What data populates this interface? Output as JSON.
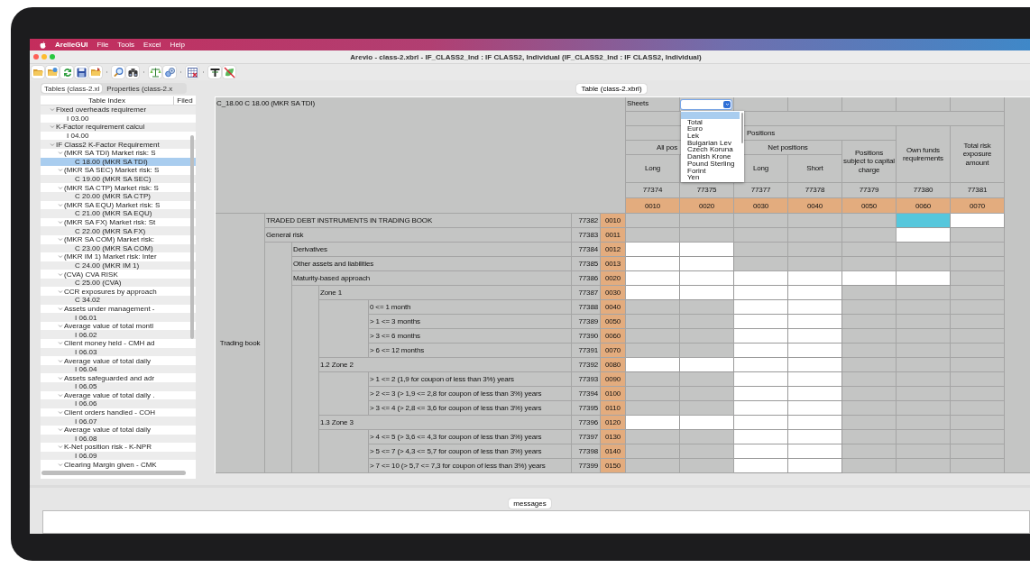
{
  "menubar": {
    "app": "ArelleGUI",
    "items": [
      "File",
      "Tools",
      "Excel",
      "Help"
    ]
  },
  "window": {
    "title": "Arevio - class-2.xbrl - IF_CLASS2_Ind : IF CLASS2, Individual (IF_CLASS2_Ind : IF CLASS2, Individual)"
  },
  "toolbar": {
    "groups": [
      [
        {
          "kind": "folder-open"
        },
        {
          "kind": "folder-star"
        },
        {
          "kind": "arrows"
        },
        {
          "kind": "disk"
        },
        {
          "kind": "folder-arrow"
        }
      ],
      [
        {
          "kind": "magnifier"
        },
        {
          "kind": "binoculars"
        }
      ],
      [
        {
          "kind": "scales"
        },
        {
          "kind": "magnifier-gear"
        }
      ],
      [
        {
          "kind": "table"
        }
      ],
      [
        {
          "kind": "tee"
        },
        {
          "kind": "crossed"
        }
      ]
    ]
  },
  "left_panel": {
    "tabs": [
      {
        "label": "Tables (class-2.xl",
        "selected": true
      },
      {
        "label": "Properties (class-2.x",
        "selected": false
      }
    ],
    "columns": [
      "Table Index",
      "Filed"
    ],
    "tree": [
      {
        "label": "Fixed overheads requiremer",
        "expanded": true,
        "selected": false,
        "children": [
          {
            "label": "I 03.00",
            "selected": false
          }
        ]
      },
      {
        "label": "K-Factor requirement calcul",
        "expanded": true,
        "selected": false,
        "children": [
          {
            "label": "I 04.00",
            "selected": false
          }
        ]
      },
      {
        "label": "IF Class2 K-Factor Requirement",
        "expanded": true,
        "selected": false,
        "children": [
          {
            "label": "(MKR SA TDI) Market risk: S",
            "expanded": true,
            "selected": false,
            "children": [
              {
                "label": "C 18.00 (MKR SA TDI)",
                "selected": true
              }
            ]
          },
          {
            "label": "(MKR SA SEC) Market risk: S",
            "expanded": true,
            "selected": false,
            "children": [
              {
                "label": "C 19.00 (MKR SA SEC)",
                "selected": false
              }
            ]
          },
          {
            "label": "(MKR SA CTP) Market risk: S",
            "expanded": true,
            "selected": false,
            "children": [
              {
                "label": "C 20.00 (MKR SA CTP)",
                "selected": false
              }
            ]
          },
          {
            "label": "(MKR SA EQU) Market risk: S",
            "expanded": true,
            "selected": false,
            "children": [
              {
                "label": "C 21.00 (MKR SA EQU)",
                "selected": false
              }
            ]
          },
          {
            "label": "(MKR SA FX) Market risk: St",
            "expanded": true,
            "selected": false,
            "children": [
              {
                "label": "C 22.00 (MKR SA FX)",
                "selected": false
              }
            ]
          },
          {
            "label": "(MKR SA COM) Market risk:",
            "expanded": true,
            "selected": false,
            "children": [
              {
                "label": "C 23.00 (MKR SA COM)",
                "selected": false
              }
            ]
          },
          {
            "label": "(MKR IM 1) Market risk: Inter",
            "expanded": true,
            "selected": false,
            "children": [
              {
                "label": "C 24.00 (MKR IM 1)",
                "selected": false
              }
            ]
          },
          {
            "label": "(CVA) CVA RISK",
            "expanded": true,
            "selected": false,
            "children": [
              {
                "label": "C 25.00 (CVA)",
                "selected": false
              }
            ]
          },
          {
            "label": "CCR exposures by approach",
            "expanded": true,
            "selected": false,
            "children": [
              {
                "label": "C 34.02",
                "selected": false
              }
            ]
          },
          {
            "label": "Assets under management -",
            "expanded": true,
            "selected": false,
            "children": [
              {
                "label": "I 06.01",
                "selected": false
              }
            ]
          },
          {
            "label": "Average value of total montl",
            "expanded": true,
            "selected": false,
            "children": [
              {
                "label": "I 06.02",
                "selected": false
              }
            ]
          },
          {
            "label": "Client money held - CMH ad",
            "expanded": true,
            "selected": false,
            "children": [
              {
                "label": "I 06.03",
                "selected": false
              }
            ]
          },
          {
            "label": "Average value of total daily",
            "expanded": true,
            "selected": false,
            "children": [
              {
                "label": "I 06.04",
                "selected": false
              }
            ]
          },
          {
            "label": "Assets safeguarded and adr",
            "expanded": true,
            "selected": false,
            "children": [
              {
                "label": "I 06.05",
                "selected": false
              }
            ]
          },
          {
            "label": "Average value of total daily .",
            "expanded": true,
            "selected": false,
            "children": [
              {
                "label": "I 06.06",
                "selected": false
              }
            ]
          },
          {
            "label": "Client orders handled - COH",
            "expanded": true,
            "selected": false,
            "children": [
              {
                "label": "I 06.07",
                "selected": false
              }
            ]
          },
          {
            "label": "Average value of total daily",
            "expanded": true,
            "selected": false,
            "children": [
              {
                "label": "I 06.08",
                "selected": false
              }
            ]
          },
          {
            "label": "K-Net position risk - K-NPR",
            "expanded": true,
            "selected": false,
            "children": [
              {
                "label": "I 06.09",
                "selected": false
              }
            ]
          },
          {
            "label": "Clearing Margin given - CMK",
            "expanded": true,
            "selected": false
          }
        ]
      }
    ]
  },
  "table_view": {
    "tab": "Table (class-2.xbrl)",
    "title": "C_18.00 C 18.00 (MKR SA TDI)",
    "sheets": {
      "label": "Sheets",
      "expanded": true,
      "blank_selected": true,
      "options": [
        {
          "label": "Total",
          "selected": false
        },
        {
          "label": "Euro",
          "selected": false
        },
        {
          "label": "Lek",
          "selected": false
        },
        {
          "label": "Bulgarian Lev",
          "selected": false
        },
        {
          "label": "Czech Koruna",
          "selected": false
        },
        {
          "label": "Danish Krone",
          "selected": false
        },
        {
          "label": "Pound Sterling",
          "selected": false
        },
        {
          "label": "Forint",
          "selected": false
        },
        {
          "label": "Yen",
          "selected": false
        }
      ]
    },
    "column_headers": {
      "positions": "Positions",
      "all_positions": "All pos",
      "net_positions": "Net positions",
      "col1": "Long",
      "col3": "Long",
      "col4": "Short",
      "col5": "Positions subject to capital charge",
      "col6": "Own funds requirements",
      "col7": "Total risk exposure amount"
    },
    "column_ids": [
      "77374",
      "77375",
      "77377",
      "77378",
      "77379",
      "77380",
      "77381"
    ],
    "column_codes": [
      "0010",
      "0020",
      "0030",
      "0040",
      "0050",
      "0060",
      "0070"
    ],
    "row_group": "Trading book",
    "rows": [
      {
        "label": "TRADED DEBT INSTRUMENTS IN TRADING BOOK",
        "id": "77382",
        "code": "0010",
        "cells": [
          {
            "kind": "blocked",
            "selected": false
          },
          {
            "kind": "blocked",
            "selected": false
          },
          {
            "kind": "blocked",
            "selected": false
          },
          {
            "kind": "blocked",
            "selected": false
          },
          {
            "kind": "blocked",
            "selected": false
          },
          {
            "kind": "input",
            "selected": true
          },
          {
            "kind": "input",
            "selected": false
          }
        ]
      },
      {
        "label": "General risk",
        "id": "77383",
        "code": "0011",
        "cells": [
          {
            "kind": "blocked",
            "selected": false
          },
          {
            "kind": "blocked",
            "selected": false
          },
          {
            "kind": "blocked",
            "selected": false
          },
          {
            "kind": "blocked",
            "selected": false
          },
          {
            "kind": "blocked",
            "selected": false
          },
          {
            "kind": "input",
            "selected": false
          },
          {
            "kind": "blocked",
            "selected": false
          }
        ],
        "children": [
          {
            "label": "Derivatives",
            "id": "77384",
            "code": "0012",
            "cells": [
              {
                "kind": "input",
                "selected": false
              },
              {
                "kind": "input",
                "selected": false
              },
              {
                "kind": "blocked",
                "selected": false
              },
              {
                "kind": "blocked",
                "selected": false
              },
              {
                "kind": "blocked",
                "selected": false
              },
              {
                "kind": "blocked",
                "selected": false
              },
              {
                "kind": "blocked",
                "selected": false
              }
            ]
          },
          {
            "label": "Other assets and liabilities",
            "id": "77385",
            "code": "0013",
            "cells": [
              {
                "kind": "input",
                "selected": false
              },
              {
                "kind": "input",
                "selected": false
              },
              {
                "kind": "blocked",
                "selected": false
              },
              {
                "kind": "blocked",
                "selected": false
              },
              {
                "kind": "blocked",
                "selected": false
              },
              {
                "kind": "blocked",
                "selected": false
              },
              {
                "kind": "blocked",
                "selected": false
              }
            ]
          },
          {
            "label": "Maturity-based approach",
            "id": "77386",
            "code": "0020",
            "cells": [
              {
                "kind": "input",
                "selected": false
              },
              {
                "kind": "input",
                "selected": false
              },
              {
                "kind": "input",
                "selected": false
              },
              {
                "kind": "input",
                "selected": false
              },
              {
                "kind": "input",
                "selected": false
              },
              {
                "kind": "input",
                "selected": false
              },
              {
                "kind": "blocked",
                "selected": false
              }
            ],
            "children": [
              {
                "label": "Zone 1",
                "id": "77387",
                "code": "0030",
                "cells": [
                  {
                    "kind": "input",
                    "selected": false
                  },
                  {
                    "kind": "input",
                    "selected": false
                  },
                  {
                    "kind": "input",
                    "selected": false
                  },
                  {
                    "kind": "input",
                    "selected": false
                  },
                  {
                    "kind": "blocked",
                    "selected": false
                  },
                  {
                    "kind": "blocked",
                    "selected": false
                  },
                  {
                    "kind": "blocked",
                    "selected": false
                  }
                ],
                "children": [
                  {
                    "label": "0 <= 1 month",
                    "id": "77388",
                    "code": "0040",
                    "cells": [
                      {
                        "kind": "blocked",
                        "selected": false
                      },
                      {
                        "kind": "blocked",
                        "selected": false
                      },
                      {
                        "kind": "input",
                        "selected": false
                      },
                      {
                        "kind": "input",
                        "selected": false
                      },
                      {
                        "kind": "blocked",
                        "selected": false
                      },
                      {
                        "kind": "blocked",
                        "selected": false
                      },
                      {
                        "kind": "blocked",
                        "selected": false
                      }
                    ]
                  },
                  {
                    "label": "> 1 <= 3 months",
                    "id": "77389",
                    "code": "0050",
                    "cells": [
                      {
                        "kind": "blocked",
                        "selected": false
                      },
                      {
                        "kind": "blocked",
                        "selected": false
                      },
                      {
                        "kind": "input",
                        "selected": false
                      },
                      {
                        "kind": "input",
                        "selected": false
                      },
                      {
                        "kind": "blocked",
                        "selected": false
                      },
                      {
                        "kind": "blocked",
                        "selected": false
                      },
                      {
                        "kind": "blocked",
                        "selected": false
                      }
                    ]
                  },
                  {
                    "label": "> 3 <= 6 months",
                    "id": "77390",
                    "code": "0060",
                    "cells": [
                      {
                        "kind": "blocked",
                        "selected": false
                      },
                      {
                        "kind": "blocked",
                        "selected": false
                      },
                      {
                        "kind": "input",
                        "selected": false
                      },
                      {
                        "kind": "input",
                        "selected": false
                      },
                      {
                        "kind": "blocked",
                        "selected": false
                      },
                      {
                        "kind": "blocked",
                        "selected": false
                      },
                      {
                        "kind": "blocked",
                        "selected": false
                      }
                    ]
                  },
                  {
                    "label": "> 6 <= 12 months",
                    "id": "77391",
                    "code": "0070",
                    "cells": [
                      {
                        "kind": "blocked",
                        "selected": false
                      },
                      {
                        "kind": "blocked",
                        "selected": false
                      },
                      {
                        "kind": "input",
                        "selected": false
                      },
                      {
                        "kind": "input",
                        "selected": false
                      },
                      {
                        "kind": "blocked",
                        "selected": false
                      },
                      {
                        "kind": "blocked",
                        "selected": false
                      },
                      {
                        "kind": "blocked",
                        "selected": false
                      }
                    ]
                  }
                ]
              },
              {
                "label": "1.2 Zone 2",
                "id": "77392",
                "code": "0080",
                "cells": [
                  {
                    "kind": "input",
                    "selected": false
                  },
                  {
                    "kind": "input",
                    "selected": false
                  },
                  {
                    "kind": "input",
                    "selected": false
                  },
                  {
                    "kind": "input",
                    "selected": false
                  },
                  {
                    "kind": "blocked",
                    "selected": false
                  },
                  {
                    "kind": "blocked",
                    "selected": false
                  },
                  {
                    "kind": "blocked",
                    "selected": false
                  }
                ],
                "children": [
                  {
                    "label": "> 1 <= 2 (1,9 for coupon of less than 3%) years",
                    "id": "77393",
                    "code": "0090",
                    "cells": [
                      {
                        "kind": "blocked",
                        "selected": false
                      },
                      {
                        "kind": "blocked",
                        "selected": false
                      },
                      {
                        "kind": "input",
                        "selected": false
                      },
                      {
                        "kind": "input",
                        "selected": false
                      },
                      {
                        "kind": "blocked",
                        "selected": false
                      },
                      {
                        "kind": "blocked",
                        "selected": false
                      },
                      {
                        "kind": "blocked",
                        "selected": false
                      }
                    ]
                  },
                  {
                    "label": "> 2 <= 3 (> 1,9 <= 2,8 for coupon of less than 3%) years",
                    "id": "77394",
                    "code": "0100",
                    "cells": [
                      {
                        "kind": "blocked",
                        "selected": false
                      },
                      {
                        "kind": "blocked",
                        "selected": false
                      },
                      {
                        "kind": "input",
                        "selected": false
                      },
                      {
                        "kind": "input",
                        "selected": false
                      },
                      {
                        "kind": "blocked",
                        "selected": false
                      },
                      {
                        "kind": "blocked",
                        "selected": false
                      },
                      {
                        "kind": "blocked",
                        "selected": false
                      }
                    ]
                  },
                  {
                    "label": "> 3 <= 4 (> 2,8 <= 3,6 for coupon of less than 3%) years",
                    "id": "77395",
                    "code": "0110",
                    "cells": [
                      {
                        "kind": "blocked",
                        "selected": false
                      },
                      {
                        "kind": "blocked",
                        "selected": false
                      },
                      {
                        "kind": "input",
                        "selected": false
                      },
                      {
                        "kind": "input",
                        "selected": false
                      },
                      {
                        "kind": "blocked",
                        "selected": false
                      },
                      {
                        "kind": "blocked",
                        "selected": false
                      },
                      {
                        "kind": "blocked",
                        "selected": false
                      }
                    ]
                  }
                ]
              },
              {
                "label": "1.3 Zone 3",
                "id": "77396",
                "code": "0120",
                "cells": [
                  {
                    "kind": "input",
                    "selected": false
                  },
                  {
                    "kind": "input",
                    "selected": false
                  },
                  {
                    "kind": "input",
                    "selected": false
                  },
                  {
                    "kind": "input",
                    "selected": false
                  },
                  {
                    "kind": "blocked",
                    "selected": false
                  },
                  {
                    "kind": "blocked",
                    "selected": false
                  },
                  {
                    "kind": "blocked",
                    "selected": false
                  }
                ],
                "children": [
                  {
                    "label": "> 4 <= 5 (> 3,6 <= 4,3 for coupon of less than 3%) years",
                    "id": "77397",
                    "code": "0130",
                    "cells": [
                      {
                        "kind": "blocked",
                        "selected": false
                      },
                      {
                        "kind": "blocked",
                        "selected": false
                      },
                      {
                        "kind": "input",
                        "selected": false
                      },
                      {
                        "kind": "input",
                        "selected": false
                      },
                      {
                        "kind": "blocked",
                        "selected": false
                      },
                      {
                        "kind": "blocked",
                        "selected": false
                      },
                      {
                        "kind": "blocked",
                        "selected": false
                      }
                    ]
                  },
                  {
                    "label": "> 5 <= 7 (> 4,3 <= 5,7 for coupon of less than 3%) years",
                    "id": "77398",
                    "code": "0140",
                    "cells": [
                      {
                        "kind": "blocked",
                        "selected": false
                      },
                      {
                        "kind": "blocked",
                        "selected": false
                      },
                      {
                        "kind": "input",
                        "selected": false
                      },
                      {
                        "kind": "input",
                        "selected": false
                      },
                      {
                        "kind": "blocked",
                        "selected": false
                      },
                      {
                        "kind": "blocked",
                        "selected": false
                      },
                      {
                        "kind": "blocked",
                        "selected": false
                      }
                    ]
                  },
                  {
                    "label": "> 7 <= 10 (> 5,7 <= 7,3 for coupon of less than 3%) years",
                    "id": "77399",
                    "code": "0150",
                    "cells": [
                      {
                        "kind": "blocked",
                        "selected": false
                      },
                      {
                        "kind": "blocked",
                        "selected": false
                      },
                      {
                        "kind": "input",
                        "selected": false
                      },
                      {
                        "kind": "input",
                        "selected": false
                      },
                      {
                        "kind": "blocked",
                        "selected": false
                      },
                      {
                        "kind": "blocked",
                        "selected": false
                      },
                      {
                        "kind": "blocked",
                        "selected": false
                      }
                    ]
                  }
                ]
              }
            ]
          }
        ]
      }
    ]
  },
  "messages": {
    "tab": "messages"
  }
}
